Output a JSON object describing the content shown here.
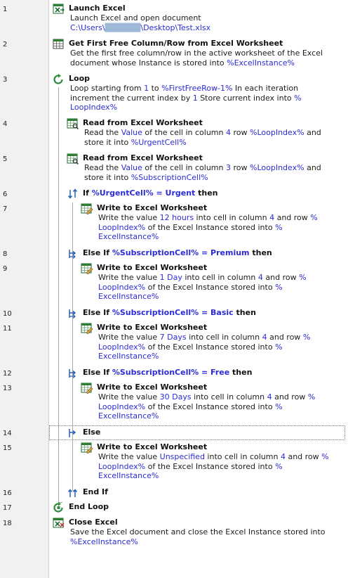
{
  "line_numbers": [
    "1",
    "2",
    "3",
    "4",
    "5",
    "6",
    "7",
    "8",
    "9",
    "10",
    "11",
    "12",
    "13",
    "14",
    "15",
    "16",
    "17",
    "18"
  ],
  "steps": {
    "launch": {
      "title": "Launch Excel",
      "line1": "Launch Excel and open document",
      "path": "C:\\Users\\",
      "path_hidden": "██████",
      "path_tail": "\\Desktop\\Test.xlsx"
    },
    "getfree": {
      "title": "Get First Free Column/Row from Excel Worksheet",
      "l1": "Get the first free column/row in the active worksheet of the Excel",
      "l2": "document whose Instance is stored into ",
      "l2v": "%ExcelInstance%"
    },
    "loop": {
      "title": "Loop",
      "a": "Loop starting from ",
      "b": "1",
      "c": " to ",
      "d": "%FirstFreeRow-1%",
      "e": " In each iteration",
      "f": "increment the current index by ",
      "g": "1",
      "h": " Store current index into ",
      "i": "%",
      "j": "LoopIndex%"
    },
    "read1": {
      "title": "Read from Excel Worksheet",
      "a": "Read the ",
      "b": "Value",
      "c": " of the cell in column ",
      "d": "4",
      "e": " row ",
      "f": "%LoopIndex%",
      "g": " and",
      "h": "store it into ",
      "i": "%UrgentCell%"
    },
    "read2": {
      "title": "Read from Excel Worksheet",
      "a": "Read the ",
      "b": "Value",
      "c": " of the cell in column ",
      "d": "3",
      "e": " row ",
      "f": "%LoopIndex%",
      "g": " and",
      "h": "store it into ",
      "i": "%SubscriptionCell%"
    },
    "if1": {
      "kw": "If ",
      "var": "%UrgentCell%",
      "op": " = ",
      "val": "Urgent",
      "then": " then"
    },
    "w1": {
      "title": "Write to Excel Worksheet",
      "pre": "Write the value ",
      "val": "12 hours",
      "mid": " into cell in column ",
      "col": "4",
      "post": " and row ",
      "pct": "%"
    },
    "elif1": {
      "kw": "Else If ",
      "var": "%SubscriptionCell%",
      "op": " = ",
      "val": "Premium",
      "then": " then"
    },
    "w2": {
      "title": "Write to Excel Worksheet",
      "pre": "Write the value ",
      "val": "1 Day",
      "mid": " into cell in column ",
      "col": "4",
      "post": " and row ",
      "pct": "%"
    },
    "elif2": {
      "kw": "Else If ",
      "var": "%SubscriptionCell%",
      "op": " = ",
      "val": "Basic",
      "then": " then"
    },
    "w3": {
      "title": "Write to Excel Worksheet",
      "pre": "Write the value ",
      "val": "7 Days",
      "mid": " into cell in column ",
      "col": "4",
      "post": " and row ",
      "pct": "%"
    },
    "elif3": {
      "kw": "Else If ",
      "var": "%SubscriptionCell%",
      "op": " = ",
      "val": "Free",
      "then": " then"
    },
    "w4": {
      "title": "Write to Excel Worksheet",
      "pre": "Write the value ",
      "val": "30 Days",
      "mid": " into cell in column ",
      "col": "4",
      "post": " and row ",
      "pct": "%"
    },
    "else": {
      "kw": "Else"
    },
    "w5": {
      "title": "Write to Excel Worksheet",
      "pre": "Write the value ",
      "val": "Unspecified",
      "mid": " into cell in column ",
      "col": "4",
      "post": " and row ",
      "pct": "%"
    },
    "endif": {
      "kw": "End If"
    },
    "endloop": {
      "kw": "End Loop"
    },
    "close": {
      "title": "Close Excel",
      "l1": "Save the Excel document and close the Excel Instance stored into",
      "l2v": "%ExcelInstance%"
    },
    "write_common": {
      "loopidx": "LoopIndex%",
      "mid2": " of the Excel Instance stored into ",
      "pct": "%",
      "inst": "ExcelInstance%"
    }
  },
  "icons": {
    "launch": "excel-launch-icon",
    "getfree": "excel-grid-icon",
    "loop": "loop-icon",
    "read": "excel-read-icon",
    "write": "excel-write-icon",
    "if": "if-icon",
    "elseif": "else-if-icon",
    "else": "else-icon",
    "endif": "end-if-icon",
    "endloop": "end-loop-icon",
    "close": "excel-close-icon"
  },
  "colors": {
    "variable": "#2b2bd6",
    "gutter": "#f1f1f1",
    "excel_green": "#2e7d32"
  }
}
